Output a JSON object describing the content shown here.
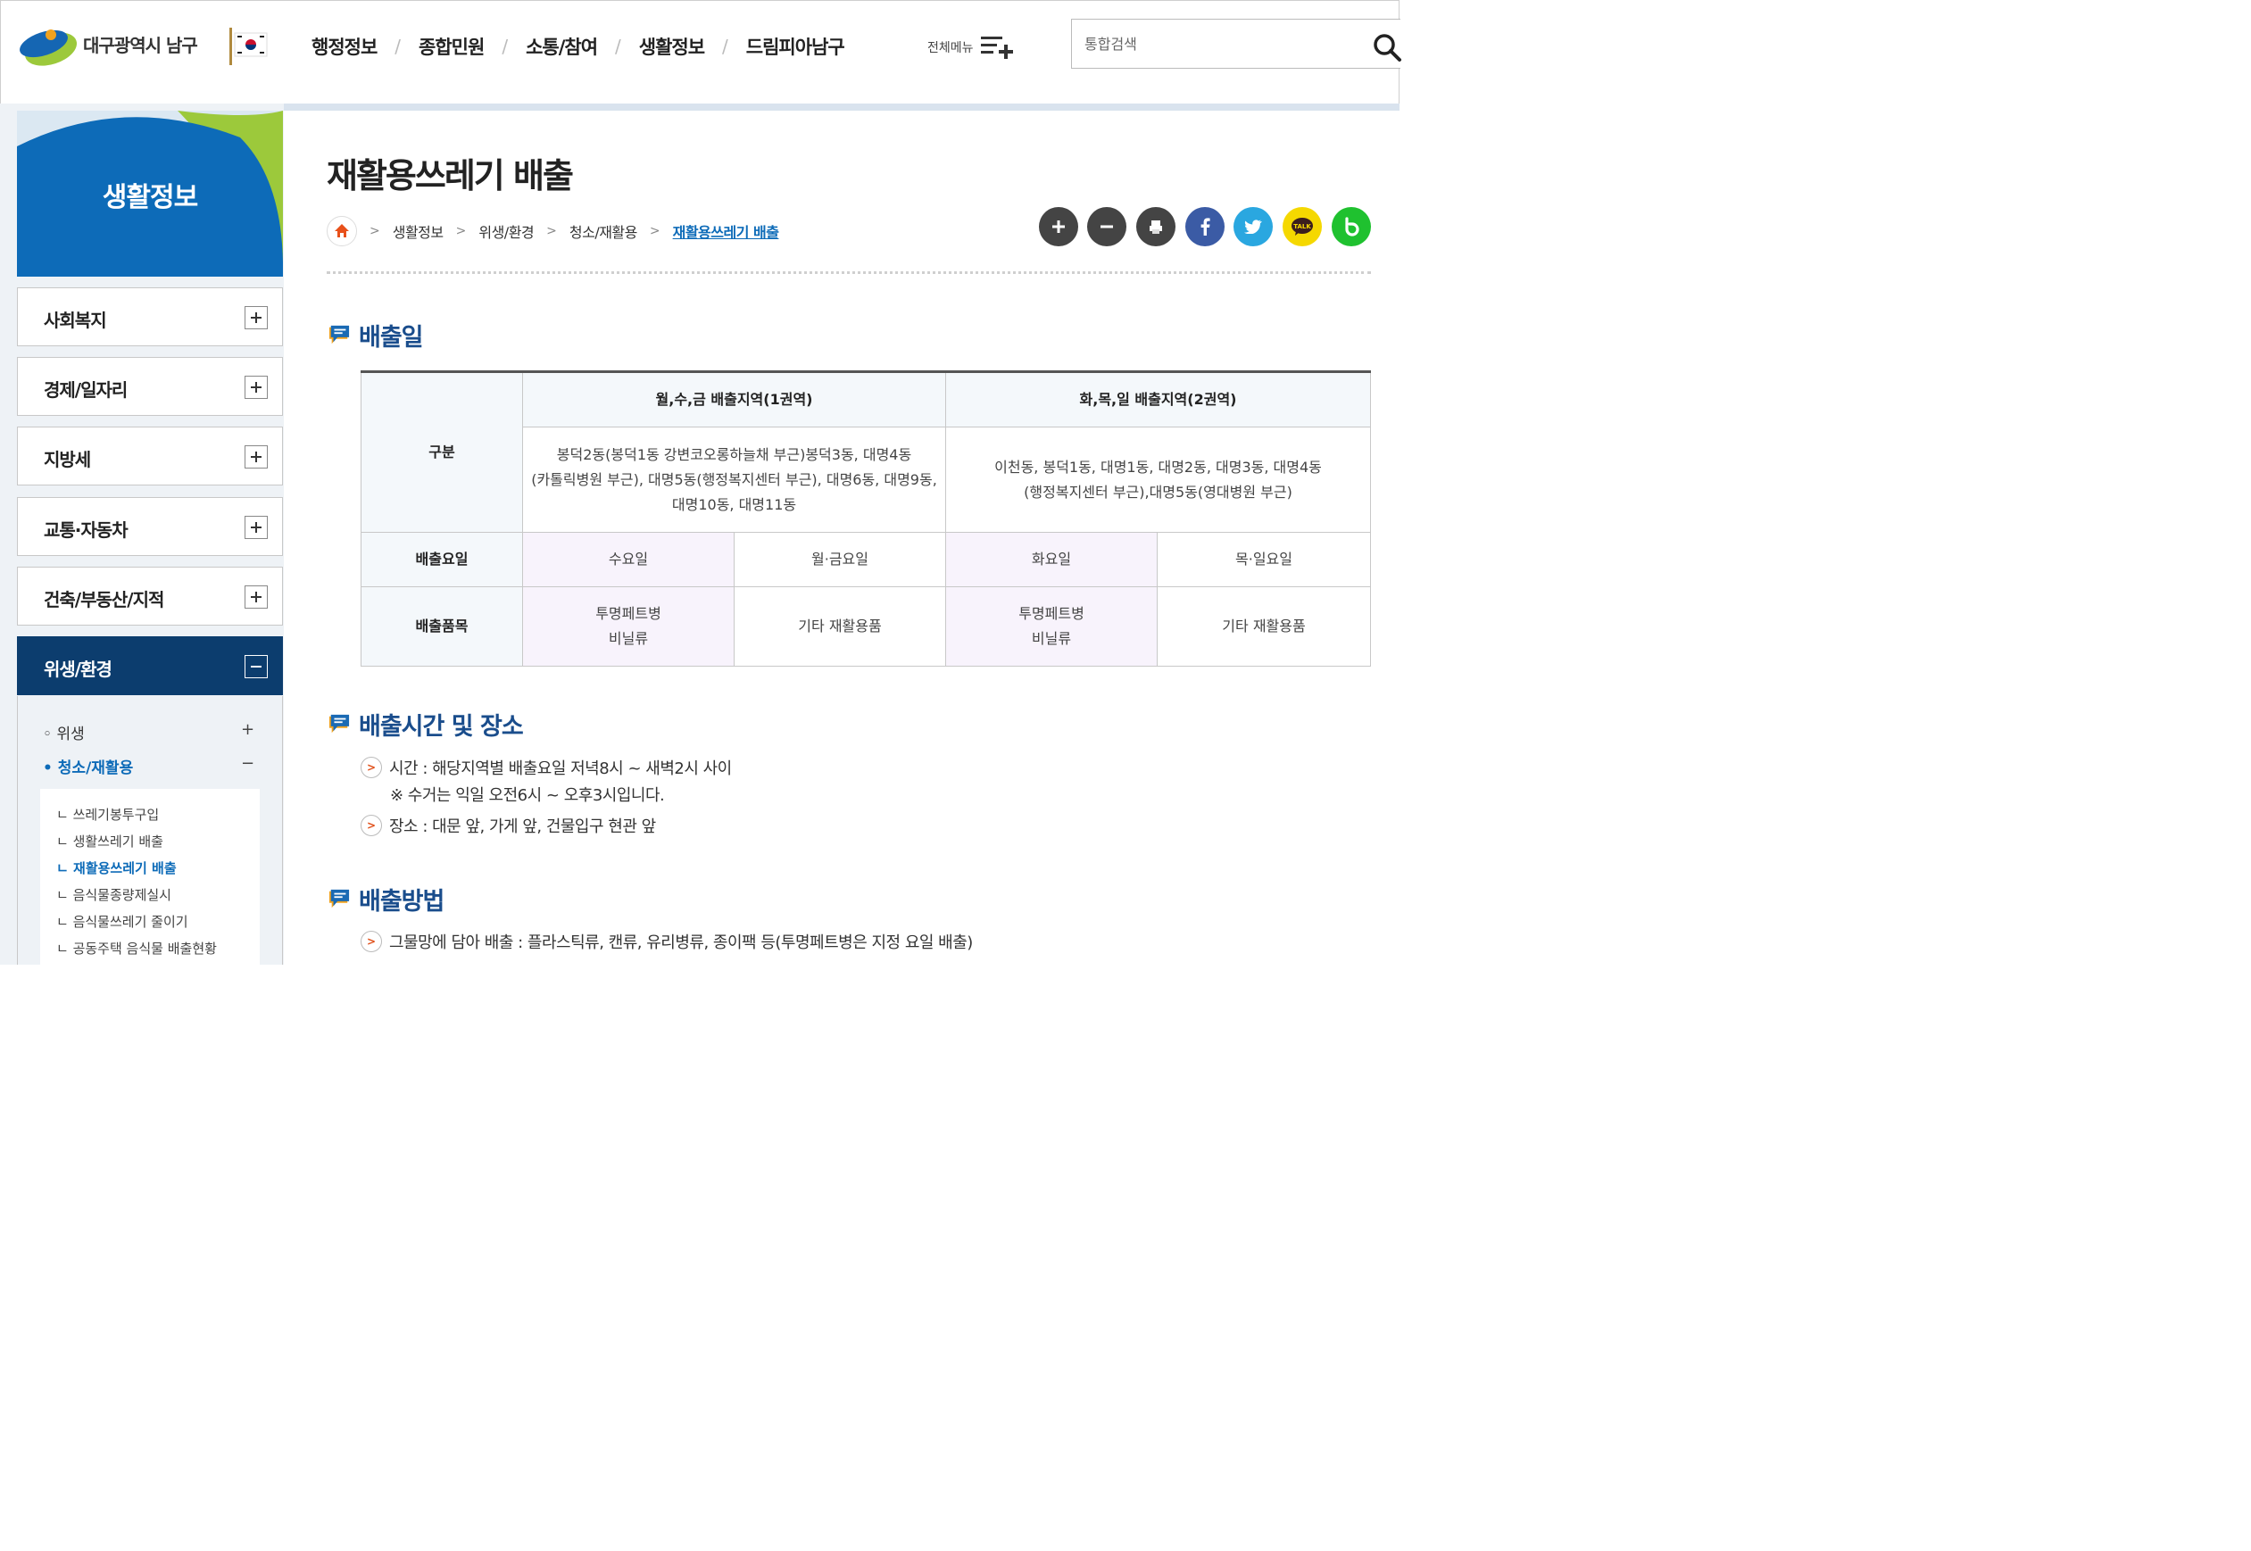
{
  "header": {
    "logo_text": "대구광역시 남구",
    "nav": [
      "행정정보",
      "종합민원",
      "소통/참여",
      "생활정보",
      "드림피아남구"
    ],
    "allmenu_label": "전체메뉴",
    "search_placeholder": "통합검색"
  },
  "sidebar": {
    "title": "생활정보",
    "menus": [
      "사회복지",
      "경제/일자리",
      "지방세",
      "교통·자동차",
      "건축/부동산/지적"
    ],
    "active_menu": "위생/환경",
    "sub_items": [
      {
        "label": "위생",
        "mark": "+"
      },
      {
        "label": "청소/재활용",
        "mark": "−"
      }
    ],
    "sub2_items": [
      "쓰레기봉투구입",
      "생활쓰레기 배출",
      "재활용쓰레기 배출",
      "음식물종량제실시",
      "음식물쓰레기 줄이기",
      "공동주택 음식물 배출현황"
    ]
  },
  "content": {
    "title": "재활용쓰레기 배출",
    "breadcrumb": [
      "생활정보",
      "위생/환경",
      "청소/재활용",
      "재활용쓰레기 배출"
    ],
    "sections": {
      "s1": "배출일",
      "s2": "배출시간 및 장소",
      "s3": "배출방법"
    },
    "table": {
      "col_head": "구분",
      "zone1": "월,수,금 배출지역(1권역)",
      "zone2": "화,목,일 배출지역(2권역)",
      "zone1_areas": [
        "봉덕2동(봉덕1동 강변코오롱하늘채 부근)봉덕3동, 대명4동",
        "(카톨릭병원 부근), 대명5동(행정복지센터 부근), 대명6동, 대명9동,",
        "대명10동, 대명11동"
      ],
      "zone2_areas": [
        "이천동, 봉덕1동, 대명1동, 대명2동, 대명3동, 대명4동",
        "(행정복지센터 부근),대명5동(영대병원 부근)"
      ],
      "row_day": "배출요일",
      "days": [
        "수요일",
        "월·금요일",
        "화요일",
        "목·일요일"
      ],
      "row_items": "배출품목",
      "items_a": [
        "투명페트병",
        "비닐류"
      ],
      "items_b": "기타 재활용품"
    },
    "time_text": "시간 : 해당지역별 배출요일 저녁8시 ~ 새벽2시 사이",
    "time_note": "※ 수거는 익일 오전6시 ~ 오후3시입니다.",
    "place_text": "장소 : 대문 앞, 가게 앞, 건물입구 현관 앞",
    "method_text": "그물망에 담아 배출 : 플라스틱류, 캔류, 유리병류, 종이팩 등(투명페트병은 지정 요일 배출)",
    "util_buttons": [
      "zoom-in",
      "zoom-out",
      "print",
      "facebook",
      "twitter",
      "kakaotalk",
      "band"
    ]
  }
}
